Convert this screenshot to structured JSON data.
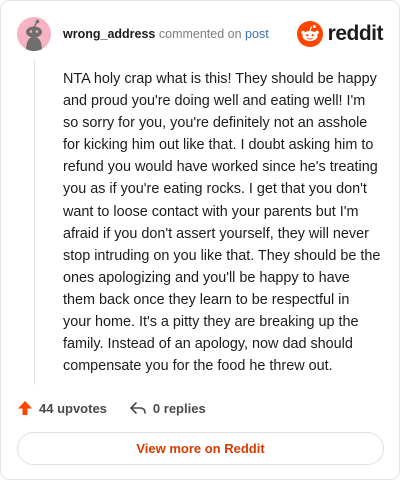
{
  "header": {
    "username": "wrong_address",
    "commented_on": "commented on",
    "post_link": "post",
    "brand": "reddit"
  },
  "comment": {
    "text": "NTA holy crap what is this! They should be happy and proud you're doing well and eating well! I'm so sorry for you, you're definitely not an asshole for kicking him out like that. I doubt asking him to refund you would have worked since he's treating you as if you're eating rocks. I get that you don't want to loose contact with your parents but I'm afraid if you don't assert yourself, they will never stop intruding on you like that. They should be the ones apologizing and you'll be happy to have them back once they learn to be respectful in your home. It's a pitty they are breaking up the family. Instead of an apology, now dad should compensate you for the food he threw out."
  },
  "actions": {
    "upvotes": "44 upvotes",
    "replies": "0 replies"
  },
  "footer": {
    "view_more": "View more on Reddit"
  },
  "colors": {
    "brand_orange": "#ff4500",
    "link_blue": "#3a72b5",
    "avatar_pink": "#f6b3c4"
  }
}
